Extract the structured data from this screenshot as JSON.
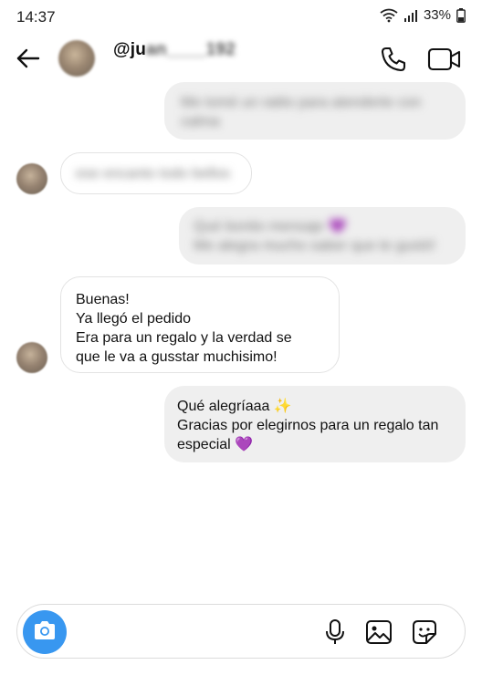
{
  "status_bar": {
    "time": "14:37",
    "battery": "33%",
    "icons": [
      "wifi-icon",
      "signal-icon",
      "battery-icon"
    ]
  },
  "header": {
    "username_visible": "@ju",
    "username_obscured": "an____192",
    "icons": [
      "back-arrow-icon",
      "phone-icon",
      "video-camera-icon"
    ]
  },
  "messages": [
    {
      "direction": "outgoing",
      "obscured": true,
      "lines": [
        "Me tomé un ratito para atenderte con",
        "calma"
      ]
    },
    {
      "direction": "incoming",
      "obscured": true,
      "lines": [
        "ese encanto todo bellos"
      ]
    },
    {
      "direction": "outgoing",
      "obscured": true,
      "lines": [
        "Qué bonito mensaje 💜",
        "Me alegra mucho saber que te gustó!"
      ]
    },
    {
      "direction": "incoming",
      "obscured": false,
      "lines": [
        "Buenas!",
        "Ya llegó el pedido",
        "Era para un regalo y la verdad se",
        "que le va a gusstar muchisimo!"
      ]
    },
    {
      "direction": "outgoing",
      "obscured": false,
      "lines": [
        "Qué alegríaaa ✨",
        "Gracias por elegirnos para un regalo tan",
        "especial 💜"
      ]
    }
  ],
  "composer": {
    "placeholder": "",
    "icons": [
      "camera-icon",
      "microphone-icon",
      "gallery-icon",
      "sticker-icon"
    ]
  },
  "colors": {
    "outgoing_bubble": "#efefef",
    "incoming_bubble_border": "#e3e3e3",
    "camera_button": "#3897f0"
  }
}
